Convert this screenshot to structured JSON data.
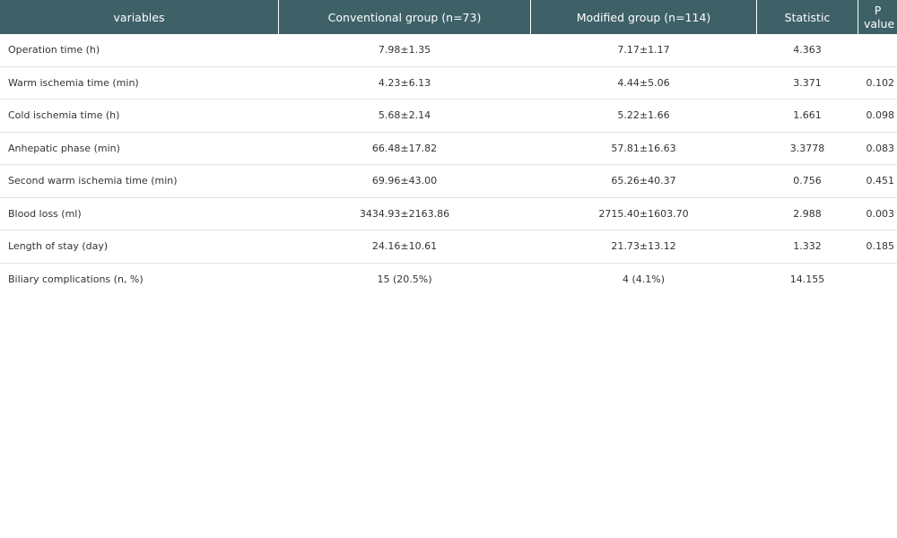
{
  "table": {
    "headers": [
      "variables",
      "Conventional group (n=73)",
      "Modified group (n=114)",
      "Statistic",
      "P value"
    ],
    "rows": [
      [
        "Operation time (h)",
        "7.98±1.35",
        "7.17±1.17",
        "4.363",
        ""
      ],
      [
        "Warm ischemia time (min)",
        "4.23±6.13",
        "4.44±5.06",
        "3.371",
        "0.102"
      ],
      [
        "Cold ischemia time (h)",
        "5.68±2.14",
        "5.22±1.66",
        "1.661",
        "0.098"
      ],
      [
        "Anhepatic phase (min)",
        "66.48±17.82",
        "57.81±16.63",
        "3.3778",
        "0.083"
      ],
      [
        "Second warm ischemia time (min)",
        "69.96±43.00",
        "65.26±40.37",
        "0.756",
        "0.451"
      ],
      [
        "Blood loss (ml)",
        "3434.93±2163.86",
        "2715.40±1603.70",
        "2.988",
        "0.003"
      ],
      [
        "Length of stay (day)",
        "24.16±10.61",
        "21.73±13.12",
        "1.332",
        "0.185"
      ],
      [
        "Biliary complications (n, %)",
        "15 (20.5%)",
        "4 (4.1%)",
        "14.155",
        ""
      ]
    ]
  },
  "colors": {
    "header_background": "#3e6168",
    "header_text": "#ffffff",
    "row_divider": "#e3e3e3",
    "body_text": "#333333"
  }
}
